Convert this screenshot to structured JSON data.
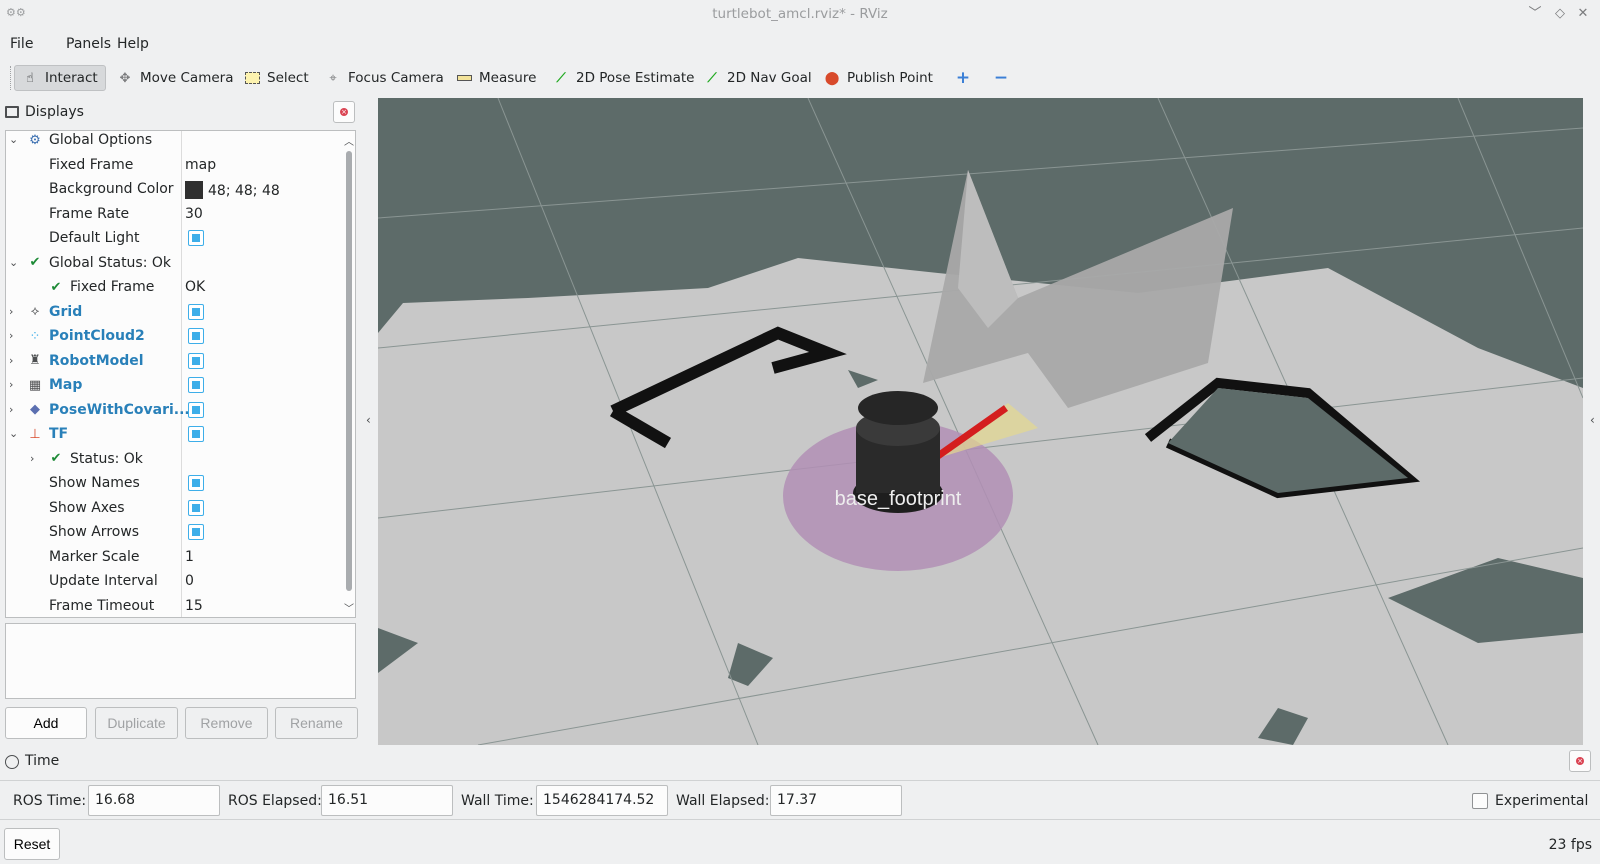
{
  "window": {
    "title": "turtlebot_amcl.rviz* - RViz",
    "app_icon": "rviz-logo-icon"
  },
  "menu": [
    "File",
    "Panels",
    "Help"
  ],
  "toolbar": {
    "tools": [
      {
        "label": "Interact",
        "icon": "hand-icon",
        "active": true
      },
      {
        "label": "Move Camera",
        "icon": "move-camera-icon",
        "active": false
      },
      {
        "label": "Select",
        "icon": "select-icon",
        "active": false
      },
      {
        "label": "Focus Camera",
        "icon": "focus-camera-icon",
        "active": false
      },
      {
        "label": "Measure",
        "icon": "ruler-icon",
        "active": false
      },
      {
        "label": "2D Pose Estimate",
        "icon": "pose-arrow-icon",
        "active": false
      },
      {
        "label": "2D Nav Goal",
        "icon": "nav-arrow-icon",
        "active": false
      },
      {
        "label": "Publish Point",
        "icon": "map-pin-icon",
        "active": false
      }
    ],
    "plus_icon": "plus-icon",
    "minus_icon": "minus-icon"
  },
  "displays": {
    "title": "Displays",
    "rows": [
      {
        "name": "Global Options",
        "value": "",
        "level": 0,
        "arrow": "v",
        "icon": "gear-icon",
        "bold": false
      },
      {
        "name": "Fixed Frame",
        "value": "map",
        "level": 1
      },
      {
        "name": "Background Color",
        "value": "48; 48; 48",
        "level": 1,
        "swatch": "#303030"
      },
      {
        "name": "Frame Rate",
        "value": "30",
        "level": 1
      },
      {
        "name": "Default Light",
        "value": "",
        "level": 1,
        "checkbox": true
      },
      {
        "name": "Global Status: Ok",
        "value": "",
        "level": 0,
        "arrow": "v",
        "icon": "check-icon"
      },
      {
        "name": "Fixed Frame",
        "value": "OK",
        "level": 1,
        "icon": "check-icon"
      },
      {
        "name": "Grid",
        "value": "",
        "level": 0,
        "arrow": ">",
        "icon": "grid-icon",
        "bold": true,
        "checkbox": true
      },
      {
        "name": "PointCloud2",
        "value": "",
        "level": 0,
        "arrow": ">",
        "icon": "pointcloud-icon",
        "bold": true,
        "checkbox": true
      },
      {
        "name": "RobotModel",
        "value": "",
        "level": 0,
        "arrow": ">",
        "icon": "robot-icon",
        "bold": true,
        "checkbox": true
      },
      {
        "name": "Map",
        "value": "",
        "level": 0,
        "arrow": ">",
        "icon": "map-icon",
        "bold": true,
        "checkbox": true
      },
      {
        "name": "PoseWithCovari...",
        "value": "",
        "level": 0,
        "arrow": ">",
        "icon": "pose-covariance-icon",
        "bold": true,
        "checkbox": true
      },
      {
        "name": "TF",
        "value": "",
        "level": 0,
        "arrow": "v",
        "icon": "tf-axes-icon",
        "bold": true,
        "checkbox": true
      },
      {
        "name": "Status: Ok",
        "value": "",
        "level": 1,
        "arrow": ">",
        "icon": "check-icon"
      },
      {
        "name": "Show Names",
        "value": "",
        "level": 1,
        "checkbox": true
      },
      {
        "name": "Show Axes",
        "value": "",
        "level": 1,
        "checkbox": true
      },
      {
        "name": "Show Arrows",
        "value": "",
        "level": 1,
        "checkbox": true
      },
      {
        "name": "Marker Scale",
        "value": "1",
        "level": 1
      },
      {
        "name": "Update Interval",
        "value": "0",
        "level": 1
      },
      {
        "name": "Frame Timeout",
        "value": "15",
        "level": 1
      }
    ],
    "buttons": {
      "add": "Add",
      "duplicate": "Duplicate",
      "remove": "Remove",
      "rename": "Rename"
    }
  },
  "viewport": {
    "frame_label": "base_footprint",
    "background_color": "#5d6b69"
  },
  "time": {
    "title": "Time",
    "ros_time_label": "ROS Time:",
    "ros_time": "16.68",
    "ros_elapsed_label": "ROS Elapsed:",
    "ros_elapsed": "16.51",
    "wall_time_label": "Wall Time:",
    "wall_time": "1546284174.52",
    "wall_elapsed_label": "Wall Elapsed:",
    "wall_elapsed": "17.37",
    "experimental_label": "Experimental"
  },
  "status": {
    "reset": "Reset",
    "fps": "23 fps"
  }
}
